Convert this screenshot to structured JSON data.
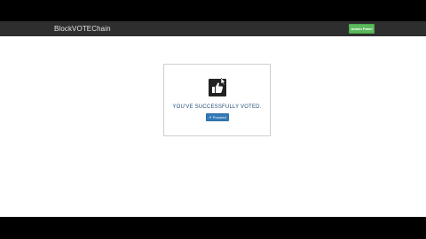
{
  "navbar": {
    "brand": "BlockVOTEChain",
    "admin_button_label": "Admin Panel"
  },
  "card": {
    "icon": "thumbs-up-icon",
    "message": "YOU'VE SUCCESSFULLY VOTED.",
    "proceed_button_label": "✔ Proceed"
  },
  "colors": {
    "navbar_bg": "#2e2e2e",
    "admin_button": "#5cb85c",
    "message_text": "#1f4e79",
    "proceed_button": "#337ab7"
  }
}
